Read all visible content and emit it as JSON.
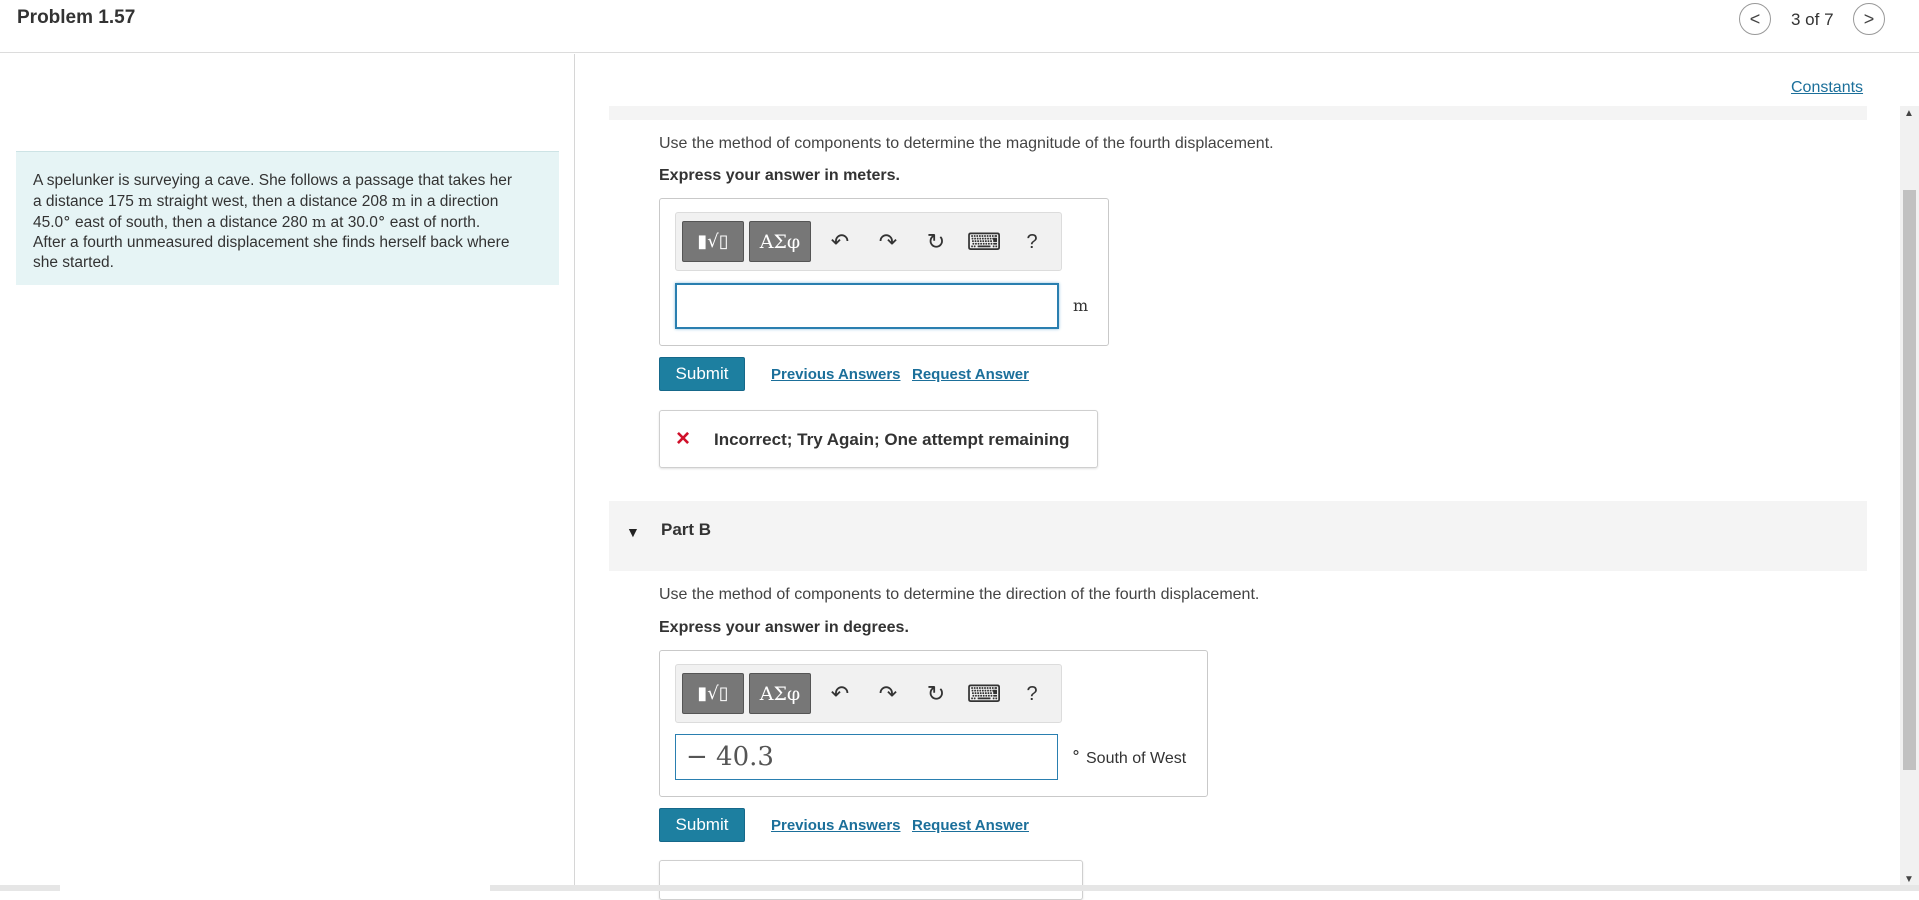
{
  "header": {
    "title": "Problem 1.57",
    "page_count": "3 of 7",
    "prev_glyph": "<",
    "next_glyph": ">"
  },
  "problem": {
    "line1": "A spelunker is surveying a cave. She follows a passage that takes her",
    "line2_a": "a distance 175 ",
    "line2_unit": "m",
    "line2_b": " straight west, then a distance 208 ",
    "line2_unit2": "m",
    "line2_c": " in a direction",
    "line3_a": "45.0",
    "line3_deg": "°",
    "line3_b": " east of south, then a distance 280 ",
    "line3_unit": "m",
    "line3_c": " at 30.0",
    "line3_deg2": "°",
    "line3_d": " east of north.",
    "line4": "After a fourth unmeasured displacement she finds herself back where",
    "line5": "she started."
  },
  "constants_link": "Constants",
  "partA": {
    "prompt": "Use the method of components to determine the magnitude of the fourth displacement.",
    "express": "Express your answer in meters.",
    "input_value": "",
    "unit": "m",
    "submit": "Submit",
    "previous_answers": "Previous Answers",
    "request_answer": "Request Answer",
    "feedback": "Incorrect; Try Again; One attempt remaining",
    "feedback_icon": "×"
  },
  "partB": {
    "label": "Part B",
    "caret": "▼",
    "prompt": "Use the method of components to determine the direction of the fourth displacement.",
    "express": "Express your answer in degrees.",
    "input_value": "− 40.3",
    "unit_deg": "°",
    "unit_text": "South of West",
    "submit": "Submit",
    "previous_answers": "Previous Answers",
    "request_answer": "Request Answer"
  },
  "toolbar": {
    "templates_glyph": "▮√▯",
    "greek_glyph": "ΑΣφ",
    "undo_glyph": "↶",
    "redo_glyph": "↷",
    "reset_glyph": "↻",
    "keyboard_glyph": "⌨",
    "help_glyph": "?"
  },
  "colors": {
    "accent": "#1d7fa0",
    "link": "#1b6f9a",
    "error": "#d0102a",
    "problem_bg": "#e6f4f5"
  }
}
